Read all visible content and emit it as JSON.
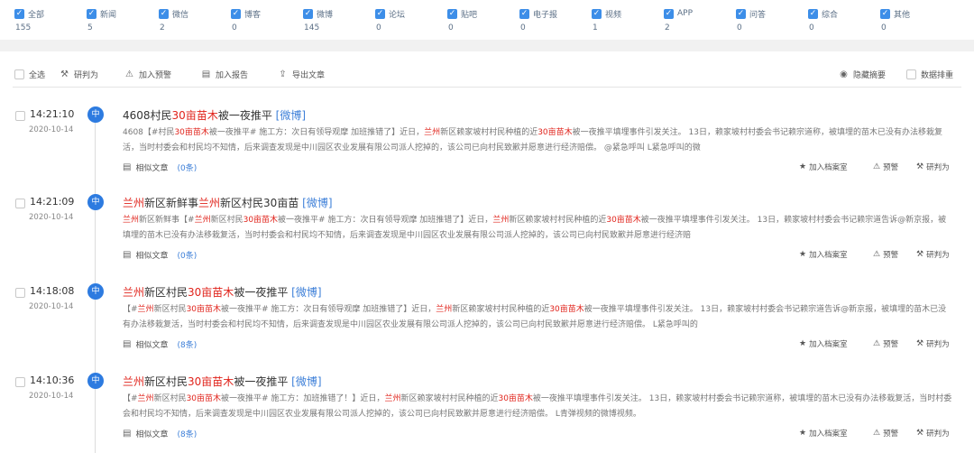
{
  "filters": [
    {
      "label": "全部",
      "count": "155"
    },
    {
      "label": "新闻",
      "count": "5"
    },
    {
      "label": "微信",
      "count": "2"
    },
    {
      "label": "博客",
      "count": "0"
    },
    {
      "label": "微博",
      "count": "145"
    },
    {
      "label": "论坛",
      "count": "0"
    },
    {
      "label": "贴吧",
      "count": "0"
    },
    {
      "label": "电子报",
      "count": "0"
    },
    {
      "label": "视频",
      "count": "1"
    },
    {
      "label": "APP",
      "count": "2"
    },
    {
      "label": "问答",
      "count": "0"
    },
    {
      "label": "综合",
      "count": "0"
    },
    {
      "label": "其他",
      "count": "0"
    }
  ],
  "toolbar": {
    "select_all": "全选",
    "judge": "研判为",
    "add_warning": "加入预警",
    "add_report": "加入报告",
    "export": "导出文章",
    "hide_summary": "隐藏摘要",
    "data_sort": "数据排重"
  },
  "entries": [
    {
      "time": "14:21:10",
      "date": "2020-10-14",
      "badge": "中",
      "title": [
        "4608村民",
        "30亩苗木",
        "被一夜推平 ",
        "[微博]"
      ],
      "summary": [
        "4608【#村民",
        "30亩苗木",
        "被一夜推平# 施工方：次日有领导观摩 加班推错了】近日，",
        "兰州",
        "新区赖家坡村村民种植的近",
        "30亩苗木",
        "被一夜推平填埋事件引发关注。 13日，赖家坡村村委会书记赖宗道称，被填埋的苗木已没有办法移栽复活，当时村委会和村民均不知情，后来调查发现是中川园区农业发展有限公司派人挖掉的，该公司已向村民致歉并愿意进行经济赔偿。 @紧急呼叫 L紧急呼叫的微"
      ],
      "similar_label": "相似文章",
      "similar_count": "(0条)",
      "actions": [
        "加入档案室",
        "预警",
        "研判为"
      ]
    },
    {
      "time": "14:21:09",
      "date": "2020-10-14",
      "badge": "中",
      "title": [
        "兰州",
        "新区新鲜事",
        "兰州",
        "新区村民30亩苗 ",
        "[微博]"
      ],
      "summary": [
        "兰州",
        "新区新鲜事【#",
        "兰州",
        "新区村民",
        "30亩苗木",
        "被一夜推平# 施工方：次日有领导观摩 加班推错了】近日，",
        "兰州",
        "新区赖家坡村村民种植的近",
        "30亩苗木",
        "被一夜推平填埋事件引发关注。 13日，赖家坡村村委会书记赖宗道告诉@新京报，被填埋的苗木已没有办法移栽复活，当时村委会和村民均不知情，后来调查发现是中川园区农业发展有限公司派人挖掉的，该公司已向村民致歉并愿意进行经济赔"
      ],
      "similar_label": "相似文章",
      "similar_count": "(0条)",
      "actions": [
        "加入档案室",
        "预警",
        "研判为"
      ]
    },
    {
      "time": "14:18:08",
      "date": "2020-10-14",
      "badge": "中",
      "title": [
        "兰州",
        "新区村民",
        "30亩苗木",
        "被一夜推平 ",
        "[微博]"
      ],
      "summary": [
        "【#",
        "兰州",
        "新区村民",
        "30亩苗木",
        "被一夜推平# 施工方：次日有领导观摩 加班推错了】近日，",
        "兰州",
        "新区赖家坡村村民种植的近",
        "30亩苗木",
        "被一夜推平填埋事件引发关注。 13日，赖家坡村村委会书记赖宗道告诉@新京报，被填埋的苗木已没有办法移栽复活，当时村委会和村民均不知情，后来调查发现是中川园区农业发展有限公司派人挖掉的，该公司已向村民致歉并愿意进行经济赔偿。 L紧急呼叫的"
      ],
      "similar_label": "相似文章",
      "similar_count": "(8条)",
      "actions": [
        "加入档案室",
        "预警",
        "研判为"
      ]
    },
    {
      "time": "14:10:36",
      "date": "2020-10-14",
      "badge": "中",
      "title": [
        "兰州",
        "新区村民",
        "30亩苗木",
        "被一夜推平 ",
        "[微博]"
      ],
      "summary": [
        "【#",
        "兰州",
        "新区村民",
        "30亩苗木",
        "被一夜推平# 施工方：加班推错了！】近日，",
        "兰州",
        "新区赖家坡村村民种植的近",
        "30亩苗木",
        "被一夜推平填埋事件引发关注。 13日，赖家坡村村委会书记赖宗道称，被填埋的苗木已没有办法移栽复活，当时村委会和村民均不知情，后来调查发现是中川园区农业发展有限公司派人挖掉的，该公司已向村民致歉并愿意进行经济赔偿。 L青弹视频的微博视频。"
      ],
      "similar_label": "相似文章",
      "similar_count": "(8条)",
      "actions": [
        "加入档案室",
        "预警",
        "研判为"
      ]
    }
  ],
  "colors": {
    "accent": "#3d8ee8",
    "highlight": "#e0231b",
    "source": "#3d7fd8",
    "badge": "#2d7be0"
  }
}
